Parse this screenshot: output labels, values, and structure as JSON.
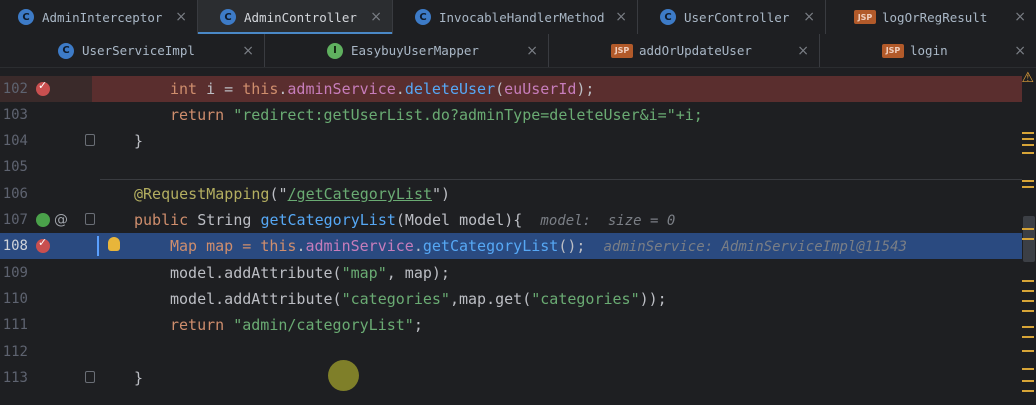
{
  "tabs_row1": [
    {
      "label": "AdminInterceptor",
      "icon": "class-icon",
      "active": false
    },
    {
      "label": "AdminController",
      "icon": "class-icon",
      "active": true
    },
    {
      "label": "InvocableHandlerMethod",
      "icon": "class-icon",
      "active": false
    },
    {
      "label": "UserController",
      "icon": "class-icon",
      "active": false
    },
    {
      "label": "logOrRegResult",
      "icon": "jsp-icon",
      "active": false
    }
  ],
  "tabs_row2": [
    {
      "label": "UserServiceImpl",
      "icon": "class-icon"
    },
    {
      "label": "EasybuyUserMapper",
      "icon": "interface-icon"
    },
    {
      "label": "addOrUpdateUser",
      "icon": "jsp-icon"
    },
    {
      "label": "login",
      "icon": "jsp-icon"
    }
  ],
  "icons": {
    "class_letter": "C",
    "interface_letter": "I",
    "jsp_letter": "JSP",
    "close": "×"
  },
  "lines": {
    "n102": "102",
    "n103": "103",
    "n104": "104",
    "n105": "105",
    "n106": "106",
    "n107": "107",
    "n108": "108",
    "n109": "109",
    "n110": "110",
    "n111": "111",
    "n112": "112",
    "n113": "113"
  },
  "code": {
    "l102_a": "int",
    "l102_b": " i = ",
    "l102_c": "this",
    "l102_d": ".",
    "l102_e": "adminService",
    "l102_f": ".",
    "l102_g": "deleteUser",
    "l102_h": "(",
    "l102_i": "euUserId",
    "l102_j": ");",
    "l103_a": "return",
    "l103_b": " \"redirect:getUserList.do?adminType=deleteUser&i=\"+i;",
    "l104": "}",
    "l106_a": "@RequestMapping",
    "l106_b": "(\"",
    "l106_c": "/getCategoryList",
    "l106_d": "\")",
    "l107_a": "public",
    "l107_b": " String ",
    "l107_c": "getCategoryList",
    "l107_d": "(Model model){",
    "l107_hint": "model:  size = 0",
    "l108_a": "Map map = ",
    "l108_b": "this",
    "l108_c": ".",
    "l108_d": "adminService",
    "l108_e": ".",
    "l108_f": "getCategoryList",
    "l108_g": "();",
    "l108_hint": "adminService: AdminServiceImpl@11543",
    "l109_a": "model.addAttribute(",
    "l109_b": "\"map\"",
    "l109_c": ", map);",
    "l110_a": "model.addAttribute(",
    "l110_b": "\"categories\"",
    "l110_c": ",map.get(",
    "l110_d": "\"categories\"",
    "l110_e": "));",
    "l111_a": "return",
    "l111_b": " \"admin/categoryList\"",
    "l111_c": ";",
    "l113": "}"
  },
  "colors": {
    "accent": "#4a88c7",
    "breakpoint": "#c94f4f",
    "current_line": "#2a4a80",
    "error_line": "#5a2e2e"
  },
  "stripe": {
    "warning_icon": "⚠"
  }
}
